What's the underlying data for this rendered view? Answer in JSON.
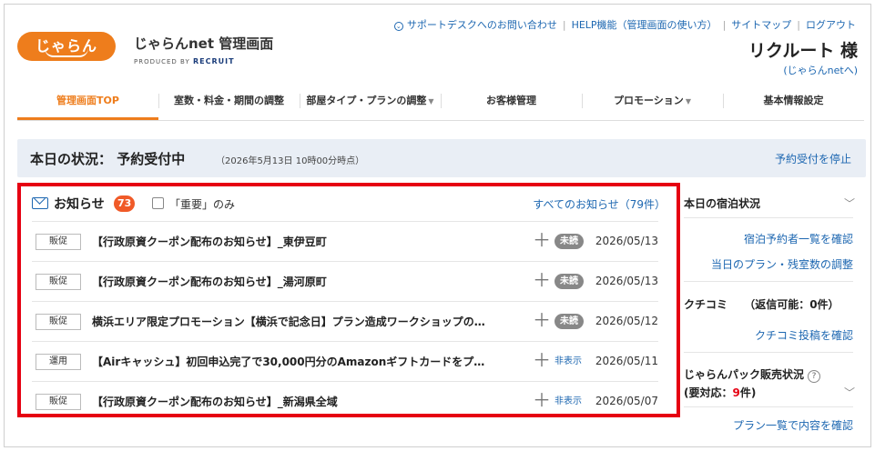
{
  "header": {
    "logo_text": "じゃらん",
    "app_title": "じゃらんnet 管理画面",
    "produced_by": "PRODUCED BY",
    "produced_brand": "RECRUIT",
    "user_name": "リクルート 様",
    "user_sub": "(じゃらんnetへ)"
  },
  "top_links": [
    {
      "label": "サポートデスクへのお問い合わせ",
      "icon": "chevron-circle-icon"
    },
    {
      "label": "HELP機能（管理画面の使い方）"
    },
    {
      "label": "サイトマップ"
    },
    {
      "label": "ログアウト"
    }
  ],
  "nav": [
    {
      "label": "管理画面TOP",
      "active": true
    },
    {
      "label": "室数・料金・期間の調整"
    },
    {
      "label": "部屋タイプ・プランの調整",
      "caret": "▼"
    },
    {
      "label": "お客様管理"
    },
    {
      "label": "プロモーション",
      "caret": "▼"
    },
    {
      "label": "基本情報設定"
    }
  ],
  "status": {
    "title": "本日の状況： 予約受付中",
    "time": "（2026年5月13日 10時00分時点）",
    "stop_link": "予約受付を停止"
  },
  "notices": {
    "title": "お知らせ",
    "count": "73",
    "important_only_label": "「重要」のみ",
    "all_link": "すべてのお知らせ（79件）",
    "items": [
      {
        "badge": "販促",
        "text": "【行政原資クーポン配布のお知らせ】_東伊豆町",
        "state": "未読",
        "state_type": "unread",
        "date": "2026/05/13"
      },
      {
        "badge": "販促",
        "text": "【行政原資クーポン配布のお知らせ】_湯河原町",
        "state": "未読",
        "state_type": "unread",
        "date": "2026/05/13"
      },
      {
        "badge": "販促",
        "text": "横浜エリア限定プロモーション【横浜で記念日】プラン造成ワークショップの…",
        "state": "未読",
        "state_type": "unread",
        "date": "2026/05/12"
      },
      {
        "badge": "運用",
        "text": "【Airキャッシュ】初回申込完了で30,000円分のAmazonギフトカードをプ…",
        "state": "非表示",
        "state_type": "hidden",
        "date": "2026/05/11"
      },
      {
        "badge": "販促",
        "text": "【行政原資クーポン配布のお知らせ】_新潟県全域",
        "state": "非表示",
        "state_type": "hidden",
        "date": "2026/05/07"
      }
    ]
  },
  "side": {
    "lodging_title": "本日の宿泊状況",
    "lodging_link1": "宿泊予約者一覧を確認",
    "lodging_link2": "当日のプラン・残室数の調整",
    "review_title": "クチコミ",
    "review_reply": "（返信可能：0件）",
    "review_link": "クチコミ投稿を確認",
    "pack_title": "じゃらんパック販売状況",
    "pack_sub_prefix": "(要対応：",
    "pack_count": "9",
    "pack_sub_suffix": "件)",
    "pack_link": "プラン一覧で内容を確認"
  }
}
